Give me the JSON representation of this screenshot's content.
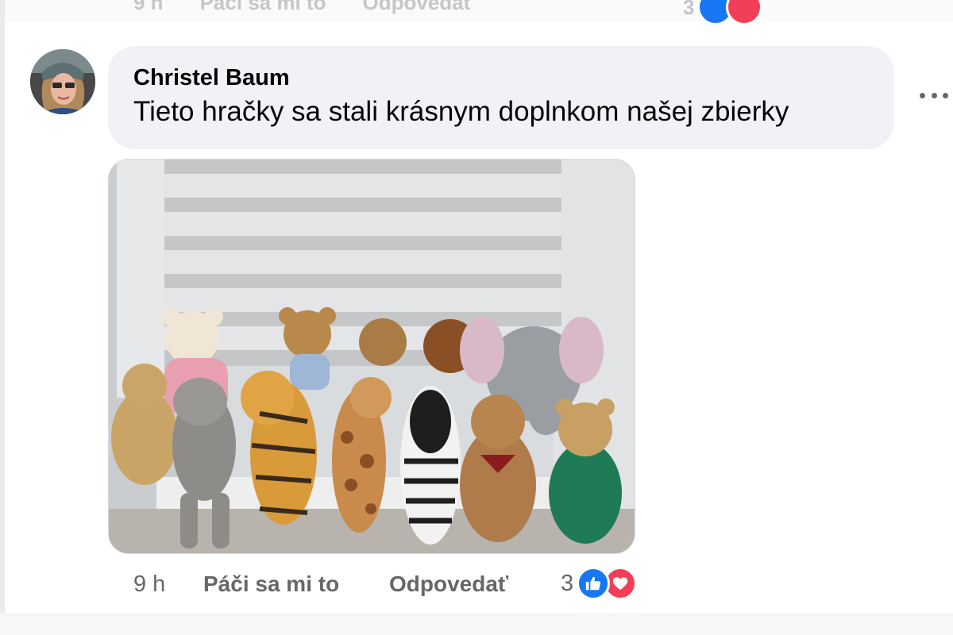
{
  "previous_comment": {
    "time": "9 h",
    "like_label": "Páči sa mi to",
    "reply_label": "Odpovedať",
    "reaction_count": "3"
  },
  "comment": {
    "author": "Christel Baum",
    "text": "Tieto hračky sa stali krásnym doplnkom našej zbierky",
    "time": "9 h",
    "like_label": "Páči sa mi to",
    "reply_label": "Odpovedať",
    "reaction_count": "3",
    "reactions": [
      "like-icon",
      "love-icon"
    ]
  },
  "colors": {
    "bubble": "#f0f2f5",
    "meta_text": "#65676b",
    "like_blue": "#1877f2",
    "love_red": "#f33e58"
  }
}
